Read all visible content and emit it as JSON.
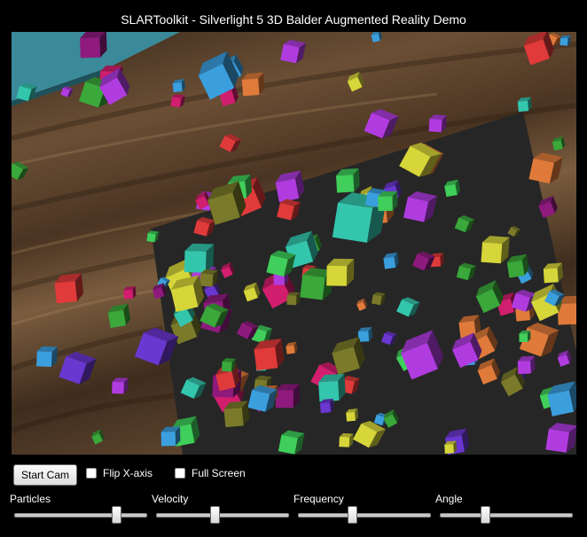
{
  "window": {
    "title": "SLARToolkit - Silverlight 5 3D Balder Augmented Reality Demo"
  },
  "controls": {
    "start_cam_label": "Start Cam",
    "flip_x_label": "Flip X-axis",
    "full_screen_label": "Full Screen",
    "flip_x_checked": false,
    "full_screen_checked": false
  },
  "sliders": [
    {
      "label": "Particles",
      "value": 0.79
    },
    {
      "label": "Velocity",
      "value": 0.44
    },
    {
      "label": "Frequency",
      "value": 0.4
    },
    {
      "label": "Angle",
      "value": 0.33
    }
  ],
  "colors": {
    "background": "#000000",
    "marker_board": "#262626",
    "table_wood": "#5a4330",
    "cube_palette": [
      "#8e1a7e",
      "#3fcf5a",
      "#3b9fde",
      "#d21e6e",
      "#6a37d0",
      "#d6d63a",
      "#34c6ad",
      "#e07a3a",
      "#b03ce0",
      "#3aa83a",
      "#7a7a2a",
      "#e03a3a"
    ]
  }
}
